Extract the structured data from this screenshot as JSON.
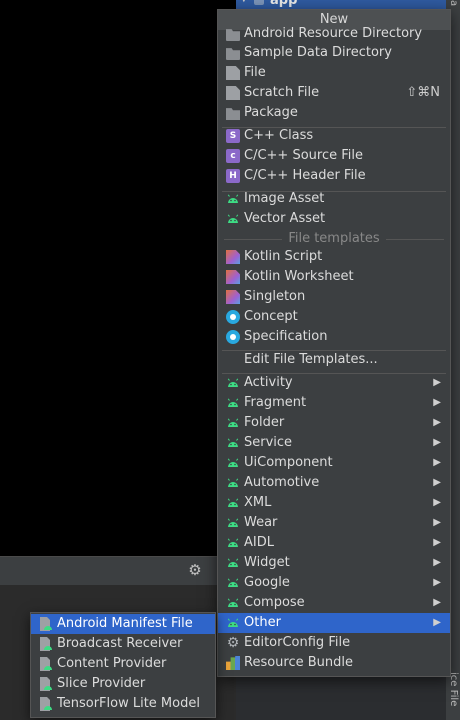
{
  "background": {
    "project_tree_item": "app",
    "side_tab_bottom": "ice File",
    "side_tab_top": "a"
  },
  "menu": {
    "title": "New",
    "items_top": [
      {
        "label": "Android Resource Directory",
        "icon": "folder-icon"
      },
      {
        "label": "Sample Data Directory",
        "icon": "folder-icon"
      },
      {
        "label": "File",
        "icon": "file-icon"
      },
      {
        "label": "Scratch File",
        "icon": "scratch-file-icon",
        "shortcut": "⇧⌘N"
      },
      {
        "label": "Package",
        "icon": "package-icon"
      }
    ],
    "items_cpp": [
      {
        "label": "C++ Class",
        "icon": "cpp-class-icon"
      },
      {
        "label": "C/C++ Source File",
        "icon": "cpp-source-icon"
      },
      {
        "label": "C/C++ Header File",
        "icon": "cpp-header-icon"
      }
    ],
    "items_assets": [
      {
        "label": "Image Asset",
        "icon": "android-icon"
      },
      {
        "label": "Vector Asset",
        "icon": "android-icon"
      }
    ],
    "file_templates_caption": "File templates",
    "items_templates": [
      {
        "label": "Kotlin Script",
        "icon": "kotlin-file-icon"
      },
      {
        "label": "Kotlin Worksheet",
        "icon": "kotlin-file-icon"
      },
      {
        "label": "Singleton",
        "icon": "kotlin-file-icon"
      },
      {
        "label": "Concept",
        "icon": "concept-icon"
      },
      {
        "label": "Specification",
        "icon": "concept-icon"
      }
    ],
    "edit_templates": "Edit File Templates...",
    "items_android": [
      {
        "label": "Activity",
        "icon": "android-icon"
      },
      {
        "label": "Fragment",
        "icon": "android-icon"
      },
      {
        "label": "Folder",
        "icon": "android-icon"
      },
      {
        "label": "Service",
        "icon": "android-icon"
      },
      {
        "label": "UiComponent",
        "icon": "android-icon"
      },
      {
        "label": "Automotive",
        "icon": "android-icon"
      },
      {
        "label": "XML",
        "icon": "android-icon"
      },
      {
        "label": "Wear",
        "icon": "android-icon"
      },
      {
        "label": "AIDL",
        "icon": "android-icon"
      },
      {
        "label": "Widget",
        "icon": "android-icon"
      },
      {
        "label": "Google",
        "icon": "android-icon"
      },
      {
        "label": "Compose",
        "icon": "android-icon"
      },
      {
        "label": "Other",
        "icon": "android-icon",
        "selected": true
      }
    ],
    "items_bottom": [
      {
        "label": "EditorConfig File",
        "icon": "gear-icon"
      },
      {
        "label": "Resource Bundle",
        "icon": "resource-bundle-icon"
      }
    ],
    "submenu_arrow": "▶"
  },
  "submenu": {
    "items": [
      {
        "label": "Android Manifest File",
        "selected": true
      },
      {
        "label": "Broadcast Receiver"
      },
      {
        "label": "Content Provider"
      },
      {
        "label": "Slice Provider"
      },
      {
        "label": "TensorFlow Lite Model"
      }
    ]
  },
  "colors": {
    "selection": "#2f65ca",
    "menu_bg": "#3c3f41",
    "android_green": "#3ddc84"
  }
}
